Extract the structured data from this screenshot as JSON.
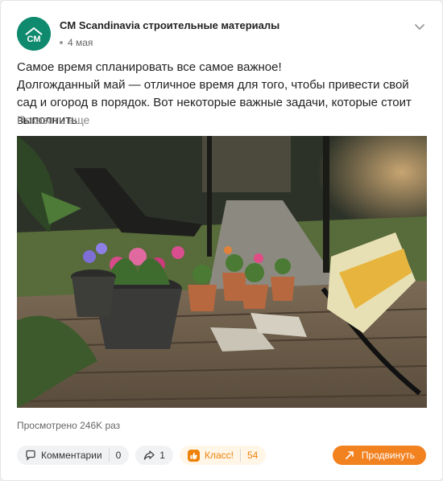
{
  "post": {
    "author": "CM Scandinavia строительные материалы",
    "avatar_text": "CM",
    "date": "4 мая",
    "text_line1": "Самое время спланировать все самое важное!",
    "text_line2": "Долгожданный май — отличное время для того, чтобы привести свой сад и огород в порядок. Вот некоторые важные задачи, которые стоит выполнить",
    "show_more": "Показать еще"
  },
  "stats": {
    "views": "Просмотрено 246K раз"
  },
  "actions": {
    "comments_label": "Комментарии",
    "comments_count": "0",
    "shares_count": "1",
    "klass_label": "Класс!",
    "klass_count": "54",
    "promote_label": "Продвинуть"
  },
  "colors": {
    "brand_green": "#0f8a6e",
    "accent_orange": "#ee8208",
    "promote_orange": "#f28120"
  }
}
